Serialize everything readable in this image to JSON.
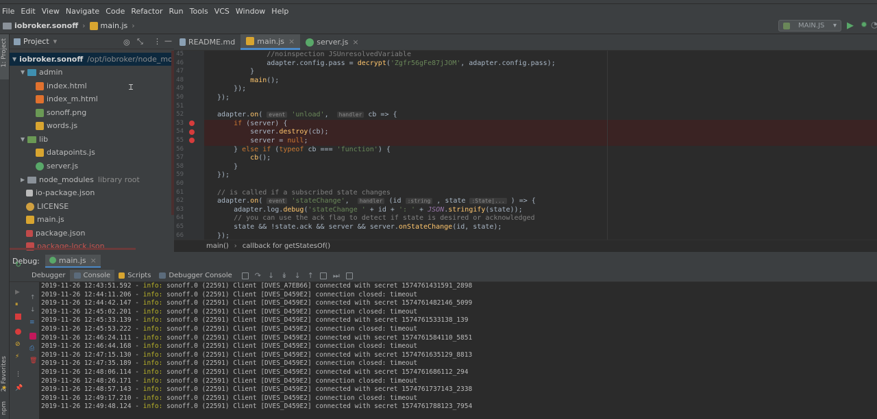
{
  "menu": [
    "File",
    "Edit",
    "View",
    "Navigate",
    "Code",
    "Refactor",
    "Run",
    "Tools",
    "VCS",
    "Window",
    "Help"
  ],
  "nav": {
    "project": "iobroker.sonoff",
    "file": "main.js",
    "run_config": "MAIN.JS"
  },
  "left_strip": {
    "project_label": "1: Project",
    "favorites_label": "2: Favorites",
    "npm_label": "npm"
  },
  "project_panel": {
    "title": "Project",
    "root_name": "iobroker.sonoff",
    "root_path": "/opt/iobroker/node_modules/iob",
    "items": [
      {
        "label": "admin",
        "kind": "folder"
      },
      {
        "label": "index.html",
        "kind": "html"
      },
      {
        "label": "index_m.html",
        "kind": "html"
      },
      {
        "label": "sonoff.png",
        "kind": "png"
      },
      {
        "label": "words.js",
        "kind": "js"
      },
      {
        "label": "lib",
        "kind": "folder"
      },
      {
        "label": "datapoints.js",
        "kind": "js"
      },
      {
        "label": "server.js",
        "kind": "js"
      },
      {
        "label": "node_modules",
        "kind": "folder",
        "suffix": "library root"
      },
      {
        "label": "io-package.json",
        "kind": "json"
      },
      {
        "label": "LICENSE",
        "kind": "license"
      },
      {
        "label": "main.js",
        "kind": "js"
      },
      {
        "label": "package.json",
        "kind": "json"
      },
      {
        "label": "package-lock.json",
        "kind": "lock"
      }
    ]
  },
  "editor": {
    "tabs": [
      {
        "label": "README.md",
        "active": false
      },
      {
        "label": "main.js",
        "active": true
      },
      {
        "label": "server.js",
        "active": false
      }
    ],
    "breadcrumb": [
      "main()",
      "callback for getStatesOf()"
    ],
    "line_numbers": [
      "45",
      "46",
      "47",
      "48",
      "49",
      "50",
      "51",
      "52",
      "53",
      "54",
      "55",
      "56",
      "57",
      "58",
      "59",
      "60",
      "61",
      "62",
      "63",
      "64",
      "65",
      "66"
    ],
    "breakpoints": [
      "53",
      "54",
      "55"
    ]
  },
  "debug": {
    "label": "Debug:",
    "config": "main.js",
    "tabs": [
      "Debugger",
      "Console",
      "Scripts",
      "Debugger Console"
    ],
    "active_tab": "Console",
    "log": [
      [
        "2019-11-26 12:43:51.592",
        "info:",
        "sonoff.0 (22591) Client [DVES_A7EB66] connected with secret 1574761431591_2898"
      ],
      [
        "2019-11-26 12:44:11.206",
        "info:",
        "sonoff.0 (22591) Client [DVES_D459E2] connection closed: timeout"
      ],
      [
        "2019-11-26 12:44:42.147",
        "info:",
        "sonoff.0 (22591) Client [DVES_D459E2] connected with secret 1574761482146_5099"
      ],
      [
        "2019-11-26 12:45:02.201",
        "info:",
        "sonoff.0 (22591) Client [DVES_D459E2] connection closed: timeout"
      ],
      [
        "2019-11-26 12:45:33.139",
        "info:",
        "sonoff.0 (22591) Client [DVES_D459E2] connected with secret 1574761533138_139"
      ],
      [
        "2019-11-26 12:45:53.222",
        "info:",
        "sonoff.0 (22591) Client [DVES_D459E2] connection closed: timeout"
      ],
      [
        "2019-11-26 12:46:24.111",
        "info:",
        "sonoff.0 (22591) Client [DVES_D459E2] connected with secret 1574761584110_5851"
      ],
      [
        "2019-11-26 12:46:44.168",
        "info:",
        "sonoff.0 (22591) Client [DVES_D459E2] connection closed: timeout"
      ],
      [
        "2019-11-26 12:47:15.130",
        "info:",
        "sonoff.0 (22591) Client [DVES_D459E2] connected with secret 1574761635129_8813"
      ],
      [
        "2019-11-26 12:47:35.189",
        "info:",
        "sonoff.0 (22591) Client [DVES_D459E2] connection closed: timeout"
      ],
      [
        "2019-11-26 12:48:06.114",
        "info:",
        "sonoff.0 (22591) Client [DVES_D459E2] connected with secret 1574761686112_294"
      ],
      [
        "2019-11-26 12:48:26.171",
        "info:",
        "sonoff.0 (22591) Client [DVES_D459E2] connection closed: timeout"
      ],
      [
        "2019-11-26 12:48:57.143",
        "info:",
        "sonoff.0 (22591) Client [DVES_D459E2] connected with secret 1574761737143_2338"
      ],
      [
        "2019-11-26 12:49:17.210",
        "info:",
        "sonoff.0 (22591) Client [DVES_D459E2] connection closed: timeout"
      ],
      [
        "2019-11-26 12:49:48.124",
        "info:",
        "sonoff.0 (22591) Client [DVES_D459E2] connected with secret 1574761788123_7954"
      ]
    ]
  },
  "colors": {
    "accent": "#4a88c7",
    "breakpoint": "#d63c3c",
    "info": "#bbb529",
    "bg": "#2b2b2b",
    "panel": "#3c3f41"
  }
}
